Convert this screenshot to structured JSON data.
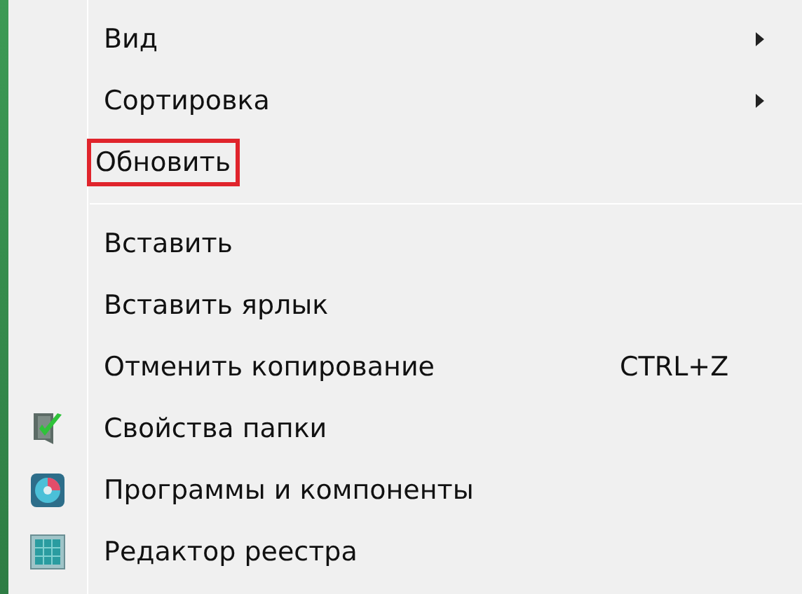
{
  "menu": {
    "items": [
      {
        "kind": "item",
        "label": "Вид",
        "submenu": true,
        "highlighted": false,
        "icon": false
      },
      {
        "kind": "item",
        "label": "Сортировка",
        "submenu": true,
        "highlighted": false,
        "icon": false
      },
      {
        "kind": "item",
        "label": "Обновить",
        "submenu": false,
        "highlighted": true,
        "icon": false
      },
      {
        "kind": "separator"
      },
      {
        "kind": "item",
        "label": "Вставить",
        "submenu": false,
        "highlighted": false,
        "icon": false
      },
      {
        "kind": "item",
        "label": "Вставить ярлык",
        "submenu": false,
        "highlighted": false,
        "icon": false
      },
      {
        "kind": "item",
        "label": "Отменить копирование",
        "shortcut": "CTRL+Z",
        "submenu": false,
        "highlighted": false,
        "icon": false
      },
      {
        "kind": "item",
        "label": "Свойства папки",
        "submenu": false,
        "highlighted": false,
        "icon": true
      },
      {
        "kind": "item",
        "label": "Программы и компоненты",
        "submenu": false,
        "highlighted": false,
        "icon": true
      },
      {
        "kind": "item",
        "label": "Редактор реестра",
        "submenu": false,
        "highlighted": false,
        "icon": true
      }
    ]
  }
}
